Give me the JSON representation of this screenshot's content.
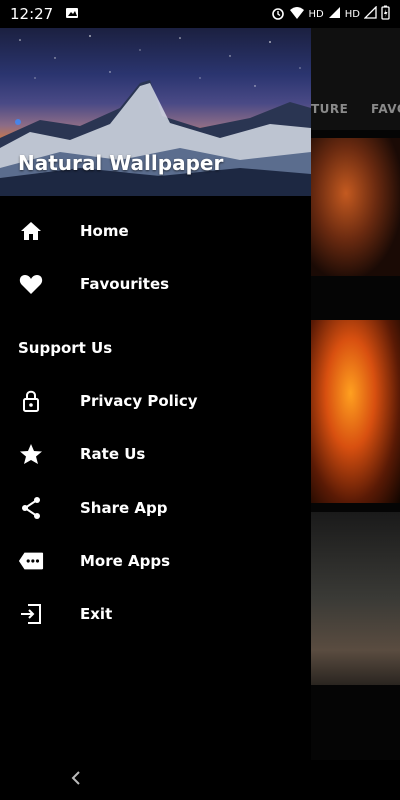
{
  "status_bar": {
    "time": "12:27",
    "network_1": "HD",
    "network_2": "HD"
  },
  "background": {
    "tabs": [
      "TURE",
      "FAVO"
    ]
  },
  "drawer": {
    "title": "Natural Wallpaper",
    "menu": [
      {
        "label": "Home",
        "icon": "home-icon"
      },
      {
        "label": "Favourites",
        "icon": "heart-icon"
      }
    ],
    "section_title": "Support Us",
    "support_menu": [
      {
        "label": "Privacy Policy",
        "icon": "lock-icon"
      },
      {
        "label": "Rate Us",
        "icon": "star-icon"
      },
      {
        "label": "Share App",
        "icon": "share-icon"
      },
      {
        "label": "More Apps",
        "icon": "more-apps-icon"
      },
      {
        "label": "Exit",
        "icon": "exit-icon"
      }
    ]
  }
}
